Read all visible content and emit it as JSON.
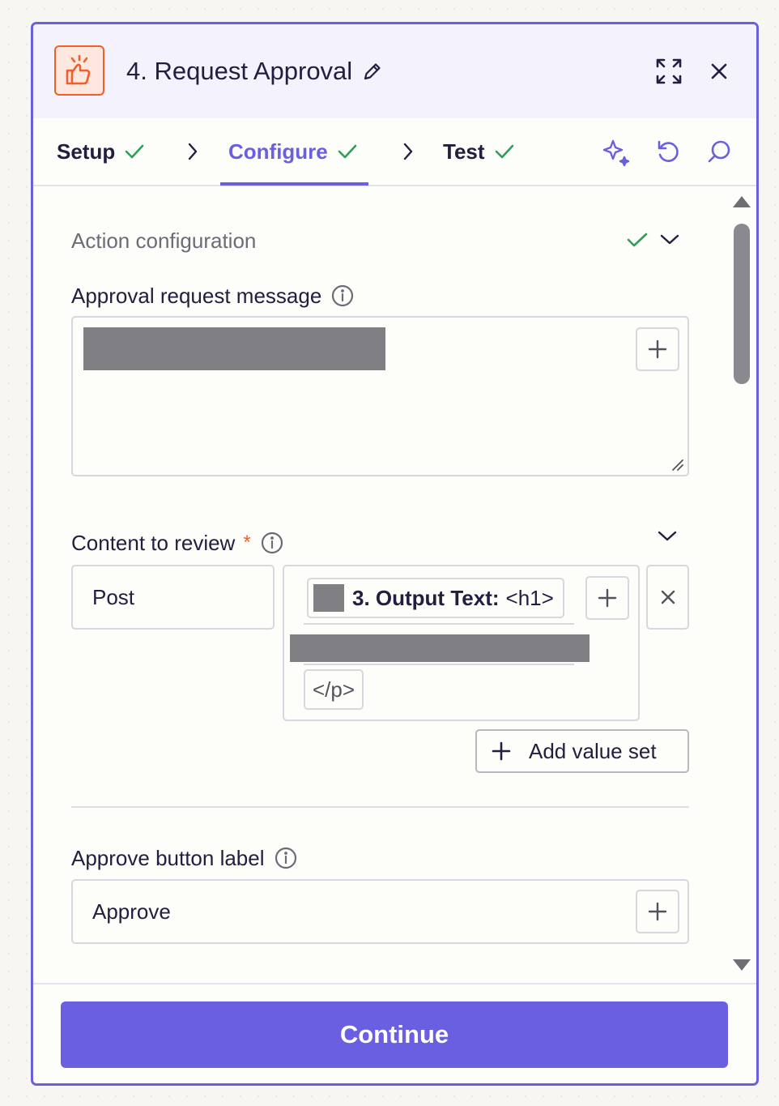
{
  "header": {
    "title": "4. Request Approval",
    "app_icon": "hand-thumbs-up-sparkle-icon",
    "brand_color": "#f05f2a"
  },
  "tabs": [
    {
      "label": "Setup",
      "complete": true,
      "active": false
    },
    {
      "label": "Configure",
      "complete": true,
      "active": true
    },
    {
      "label": "Test",
      "complete": true,
      "active": false
    }
  ],
  "colors": {
    "accent": "#6b5fe1",
    "success": "#2f9e58",
    "required": "#f05f2a"
  },
  "section": {
    "label": "Action configuration"
  },
  "fields": {
    "approval_message": {
      "label": "Approval request message"
    },
    "content_to_review": {
      "label": "Content to review",
      "required_mark": "*",
      "key_value": "Post",
      "pill_step": "3. Output Text:",
      "pill_tag": "<h1>",
      "closing_tag": "</p>",
      "add_value_set_label": "Add value set"
    },
    "approve_button_label": {
      "label": "Approve button label",
      "value": "Approve"
    }
  },
  "footer": {
    "continue_label": "Continue"
  }
}
